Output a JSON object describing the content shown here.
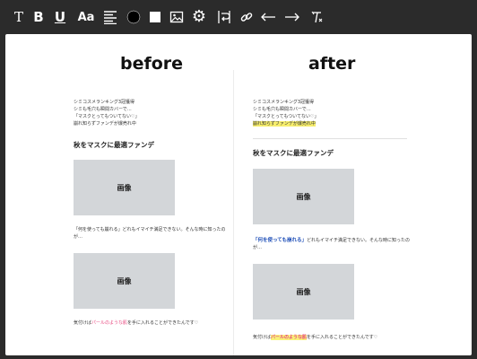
{
  "toolbar": {
    "tools": [
      {
        "name": "text-tool",
        "glyph": "T"
      },
      {
        "name": "bold-tool",
        "glyph": "B"
      },
      {
        "name": "underline-tool",
        "glyph": "U"
      },
      {
        "name": "font-size-tool",
        "glyph": "Aa"
      },
      {
        "name": "align-tool"
      },
      {
        "name": "color-tool"
      },
      {
        "name": "background-tool"
      },
      {
        "name": "image-tool"
      },
      {
        "name": "settings-tool"
      },
      {
        "name": "wrap-tool"
      },
      {
        "name": "link-tool"
      },
      {
        "name": "undo-tool"
      },
      {
        "name": "redo-tool"
      },
      {
        "name": "clear-format-tool"
      }
    ]
  },
  "before": {
    "title": "before",
    "intro_lines": [
      "シミコスメランキング3冠獲得",
      "シミも毛穴も瞬間カバーで…",
      "「マスクとってもついてない♡」",
      "崩れ知らずファンデが爆売れ中"
    ],
    "subheading": "秋をマスクに最適ファンデ",
    "image_label": "画像",
    "mid_text_line1": "「何を使っても崩れる」どれもイマイチ満足できない。そんな時に知ったの",
    "mid_text_line2": "が…",
    "image_label_2": "画像",
    "closing_prefix": "気付けば",
    "closing_highlight": "パールのような肌",
    "closing_suffix": "を手に入れることができたんです♡"
  },
  "after": {
    "title": "after",
    "intro_lines": [
      "シミコスメランキング3冠獲得",
      "シミも毛穴も瞬間カバーで…",
      "「マスクとってもついてない♡」"
    ],
    "intro_highlight": "崩れ知らずファンデが爆売れ中",
    "subheading": "秋をマスクに最適ファンデ",
    "image_label": "画像",
    "quote_bold": "「何を使っても崩れる」",
    "mid_text_rest": "どれもイマイチ満足できない。そんな時に知ったの",
    "mid_text_line2": "が…",
    "image_label_2": "画像",
    "closing_prefix": "気付けば",
    "closing_highlight": "パールのような肌",
    "closing_suffix": "を手に入れることができたんです♡"
  },
  "colors": {
    "toolbar_bg": "#2b2b2b",
    "canvas_bg": "#ffffff",
    "placeholder": "#d3d6d9",
    "highlight_yellow": "#f7ee6d",
    "accent_pink": "#e8477f",
    "accent_blue": "#1f4fb8"
  }
}
